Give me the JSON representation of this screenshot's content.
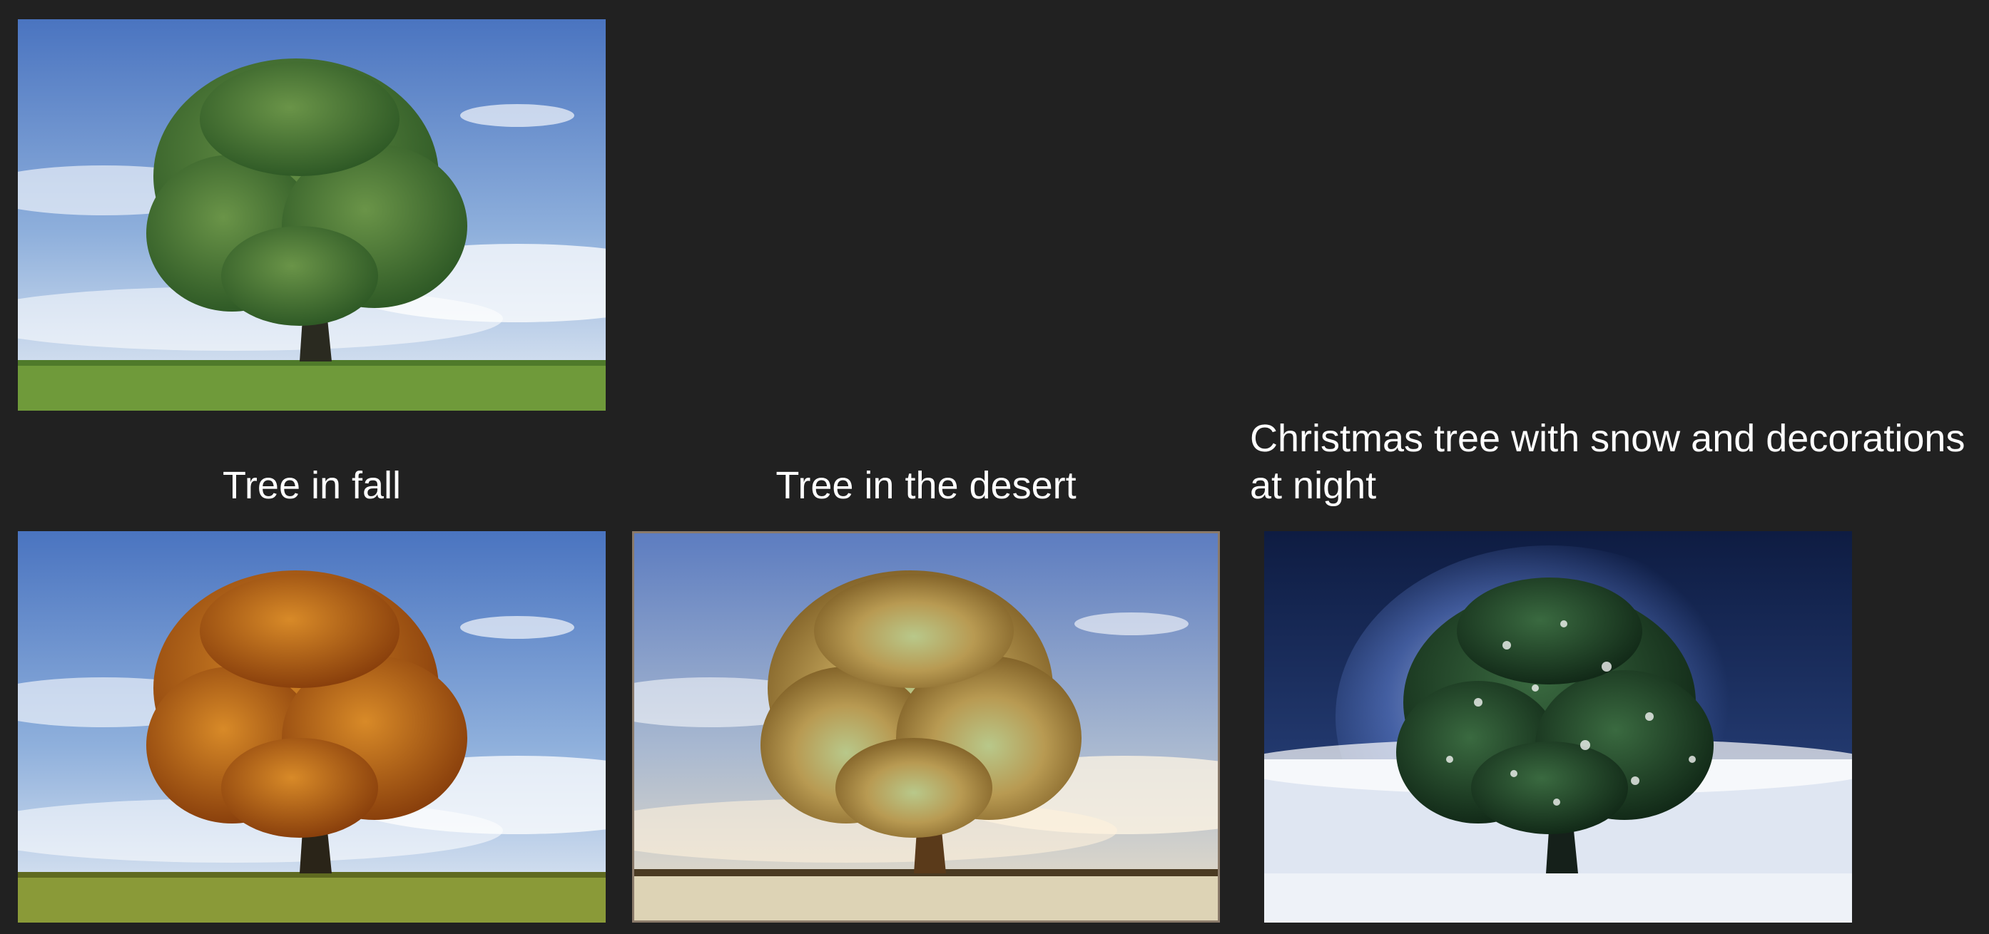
{
  "original": {
    "alt": "Tree"
  },
  "edits": [
    {
      "id": "fall",
      "caption": "Tree in fall"
    },
    {
      "id": "desert",
      "caption": "Tree in the desert"
    },
    {
      "id": "xmas",
      "caption_line1": "Christmas tree with snow and decorations",
      "caption_line2": "at night"
    }
  ],
  "colors": {
    "background": "#212121",
    "caption_text": "#ffffff",
    "sky_top": "#4a74c0",
    "sky_bottom": "#c8d8ea",
    "grass": "#6f9a3a",
    "foliage_summer": "#4d7a35",
    "foliage_fall": "#c06a14",
    "foliage_desert": "#b89a52",
    "sand": "#ddd3b5",
    "night_sky": "#14244a",
    "snow": "#e6ecf5",
    "foliage_xmas": "#1f4a2a"
  }
}
